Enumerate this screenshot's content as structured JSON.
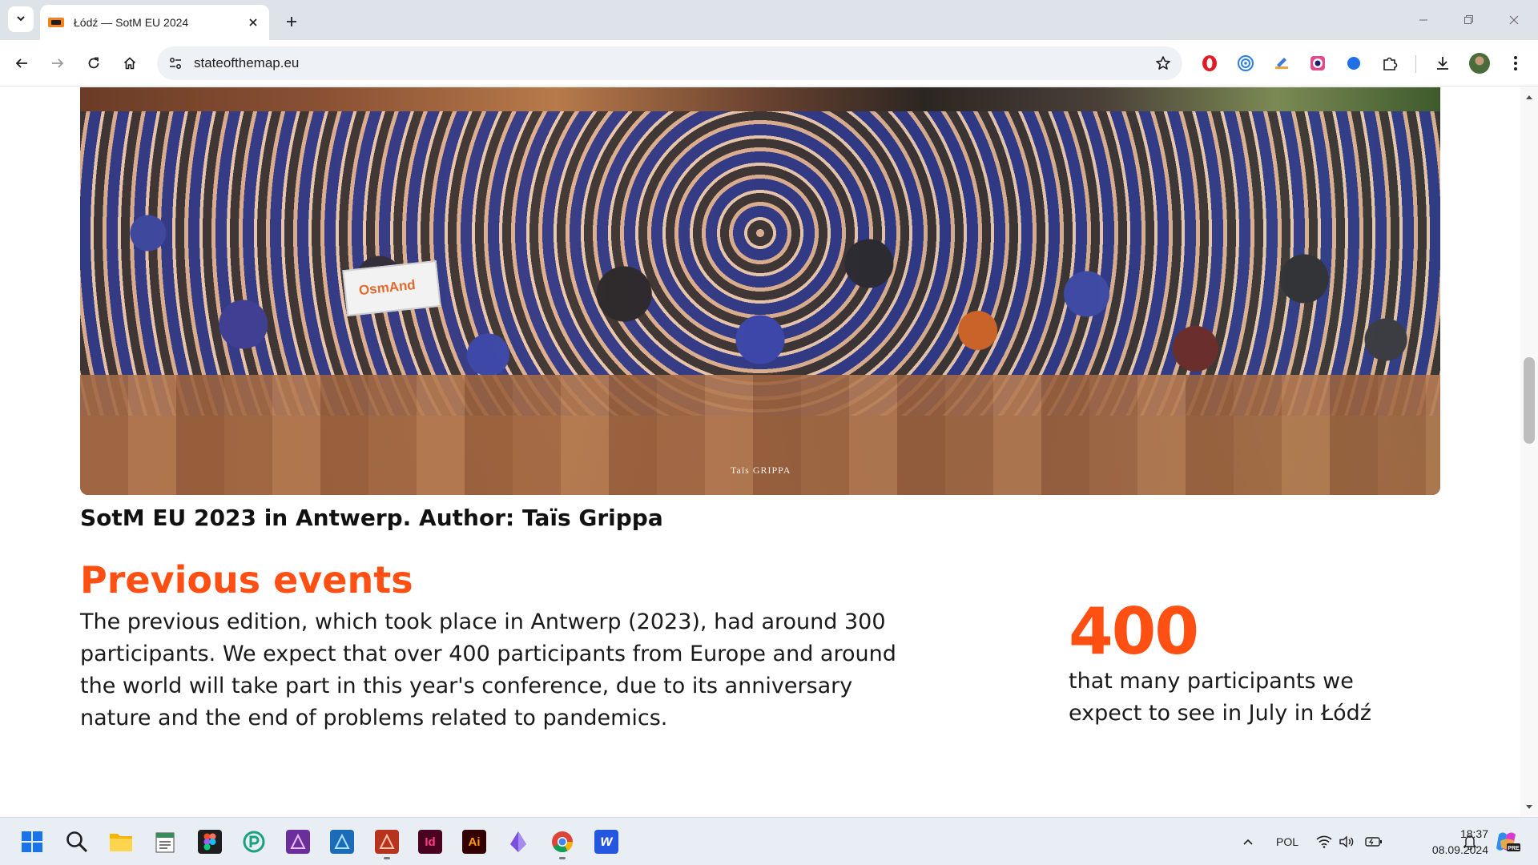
{
  "browser": {
    "tab_title": "Łódź — SotM EU 2024",
    "url": "stateofthemap.eu"
  },
  "page": {
    "photo_credit": "Taïs GRIPPA",
    "photo_banner_text": "OsmAnd",
    "caption": "SotM EU 2023 in Antwerp. Author: Taïs Grippa",
    "section_title": "Previous events",
    "body": "The previous edition, which took place in Antwerp (2023), had around 300 participants. We expect that over 400 participants from Europe and around the world will take part in this year's conference, due to its anniversary nature and the end of problems related to pandemics.",
    "stat_number": "400",
    "stat_text": "that many participants we expect to see in July in Łódź"
  },
  "taskbar": {
    "language": "POL",
    "time": "18:37",
    "date": "08.09.2024",
    "apps": [
      "windows-start",
      "search",
      "file-explorer",
      "notepad",
      "figma",
      "app-p",
      "affinity-photo",
      "affinity-designer",
      "affinity-publisher",
      "indesign",
      "illustrator",
      "app-crystal",
      "chrome",
      "app-w"
    ],
    "app_labels": {
      "indesign": "Id",
      "illustrator": "Ai",
      "app_w": "w",
      "copilot_badge": "PRE"
    }
  },
  "colors": {
    "accent": "#ff4f12",
    "text": "#1a1a1a",
    "tabstrip": "#dee3ea",
    "omnibox": "#eef1f5"
  }
}
